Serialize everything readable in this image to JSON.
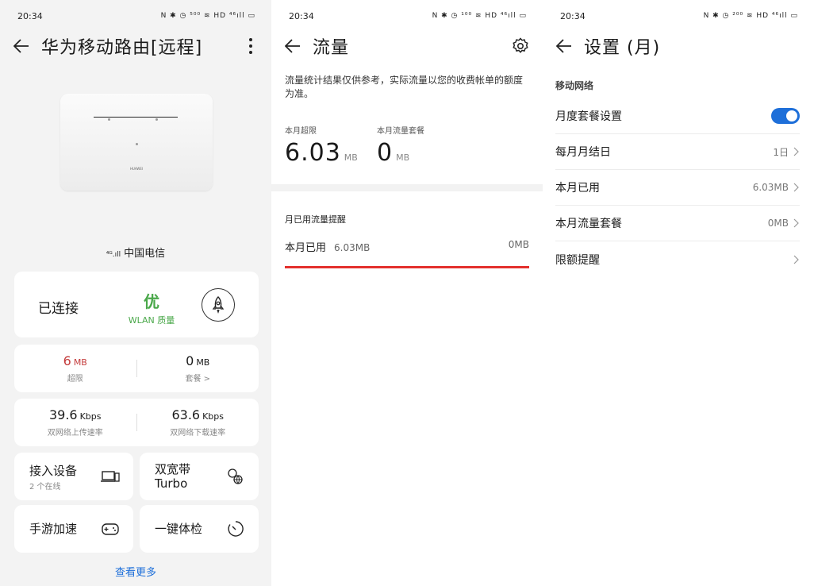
{
  "status": {
    "time": "20:34",
    "icons_text_1": "N ✱ ◷ ⁵⁰⁰ ≋ HD ⁴⁶ıll ▭",
    "icons_text_2": "N ✱ ◷ ¹⁰⁰ ≋ HD ⁴⁶ıll ▭",
    "icons_text_3": "N ✱ ◷ ²⁰⁰ ≋ HD ⁴⁶ıll ▭"
  },
  "router_screen": {
    "title": "华为移动路由[远程]",
    "device_brand": "HUAWEI",
    "carrier_signal": "⁴ᴳ.ıll",
    "carrier": "中国电信",
    "connection": {
      "status": "已连接",
      "quality_value": "优",
      "quality_label": "WLAN 质量"
    },
    "usage": {
      "over_value": "6",
      "over_unit": "MB",
      "over_label": "超限",
      "plan_value": "0",
      "plan_unit": "MB",
      "plan_label": "套餐 >"
    },
    "speed": {
      "upload_value": "39.6",
      "upload_unit": "Kbps",
      "upload_label": "双网络上传速率",
      "download_value": "63.6",
      "download_unit": "Kbps",
      "download_label": "双网络下载速率"
    },
    "tiles": {
      "devices_title": "接入设备",
      "devices_sub": "2 个在线",
      "dualband_title_1": "双宽带",
      "dualband_title_2": "Turbo",
      "game_title": "手游加速",
      "checkup_title": "一键体检"
    },
    "see_more": "查看更多"
  },
  "traffic_screen": {
    "title": "流量",
    "note": "流量统计结果仅供参考，实际流量以您的收费帐单的额度为准。",
    "over_label": "本月超限",
    "over_value": "6.03",
    "over_unit": "MB",
    "plan_label": "本月流量套餐",
    "plan_value": "0",
    "plan_unit": "MB",
    "reminder_title": "月已用流量提醒",
    "used_label": "本月已用",
    "used_value": "6.03MB",
    "plan_total": "0MB",
    "used_fraction": 1.0
  },
  "settings_screen": {
    "title": "设置 (月)",
    "group_title": "移动网络",
    "rows": [
      {
        "label": "月度套餐设置",
        "value": ""
      },
      {
        "label": "每月月结日",
        "value": "1日"
      },
      {
        "label": "本月已用",
        "value": "6.03MB"
      },
      {
        "label": "本月流量套餐",
        "value": "0MB"
      },
      {
        "label": "限额提醒",
        "value": ""
      }
    ],
    "toggle_on": true
  },
  "colors": {
    "accent": "#1e6fd9",
    "good": "#4aa84a",
    "over": "#c43c3c",
    "bar": "#e3302d"
  }
}
